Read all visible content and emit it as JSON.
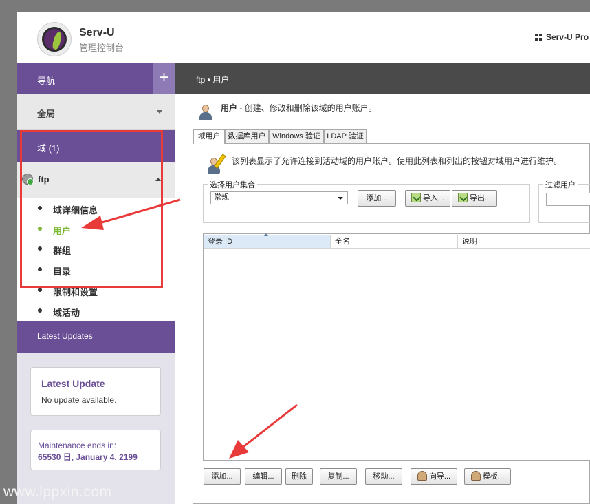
{
  "header": {
    "app_title": "Serv-U",
    "app_subtitle": "管理控制台",
    "product_link": "Serv-U Pro"
  },
  "sidebar": {
    "nav_label": "导航",
    "plus_label": "+",
    "global_label": "全局",
    "domain_label": "域 (1)",
    "ftp_label": "ftp",
    "subnav": [
      {
        "label": "域详细信息",
        "active": false
      },
      {
        "label": "用户",
        "active": true
      },
      {
        "label": "群组",
        "active": false
      },
      {
        "label": "目录",
        "active": false
      },
      {
        "label": "限制和设置",
        "active": false
      },
      {
        "label": "域活动",
        "active": false
      }
    ],
    "latest_updates_header": "Latest Updates",
    "latest_update_title": "Latest Update",
    "latest_update_text": "No update available.",
    "maintenance_label": "Maintenance ends in:",
    "maintenance_date": "65530 日, January 4, 2199"
  },
  "watermark": "www.lppxin.com",
  "main": {
    "breadcrumb": "ftp • 用户",
    "page_desc_bold": "用户",
    "page_desc_rest": " - 创建、修改和删除该域的用户账户。",
    "tabs": [
      {
        "label": "域用户",
        "active": true
      },
      {
        "label": "数据库用户",
        "active": false
      },
      {
        "label": "Windows 验证",
        "active": false
      },
      {
        "label": "LDAP 验证",
        "active": false
      }
    ],
    "panel_desc": "该列表显示了允许连接到活动域的用户账户。使用此列表和列出的按钮对域用户进行维护。",
    "collection_legend": "选择用户集合",
    "collection_value": "常规",
    "collection_add": "添加...",
    "import_label": "导入...",
    "export_label": "导出...",
    "filter_legend": "过滤用户",
    "columns": [
      "登录 ID",
      "全名",
      "说明"
    ],
    "bottom_buttons": {
      "add": "添加...",
      "edit": "编辑...",
      "delete": "删除",
      "copy": "复制...",
      "move": "移动...",
      "wizard": "向导...",
      "template": "模板..."
    }
  },
  "colors": {
    "accent_purple": "#6a4f97",
    "active_green": "#7ab830",
    "annotation_red": "#e93a3a"
  }
}
